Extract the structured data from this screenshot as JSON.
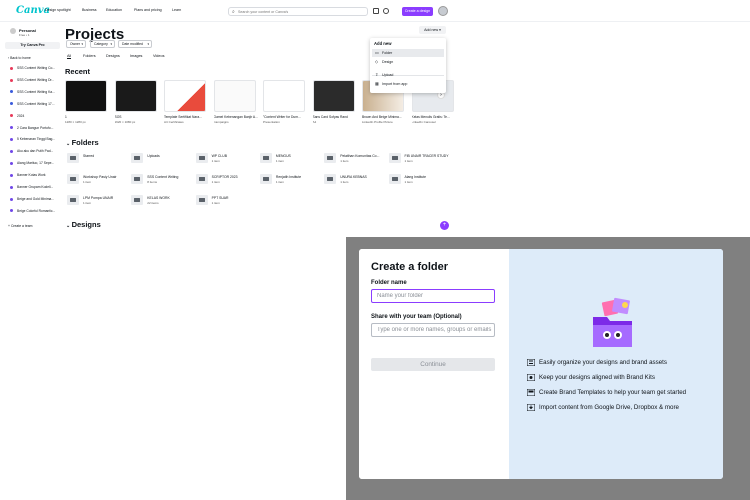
{
  "topbar": {
    "logo": "Canva",
    "nav": [
      "Design spotlight",
      "Business",
      "Education",
      "Plans and pricing",
      "Learn"
    ],
    "search_placeholder": "Search your content or Canva's",
    "create_design": "Create a design"
  },
  "sidebar": {
    "team_name": "Personal",
    "team_sub": "Free • 1",
    "try_pro": "Try Canva Pro",
    "back_home": "Back to home",
    "items": [
      {
        "label": "SSS Content Writing Co...",
        "color": "#e83a5a"
      },
      {
        "label": "SSS Content Writing Dr...",
        "color": "#e83a5a"
      },
      {
        "label": "SSS Content Writing Ka...",
        "color": "#3b5bdb"
      },
      {
        "label": "SSS Content Writing 17...",
        "color": "#3b5bdb"
      },
      {
        "label": "2024",
        "color": "#e83a5a"
      },
      {
        "label": "2 Cara Bangun Portofo...",
        "color": "#7048e8"
      },
      {
        "label": "5 Kebenaran Tinggi Bag...",
        "color": "#7048e8"
      },
      {
        "label": "Aku aku dan Putih Pad...",
        "color": "#7048e8"
      },
      {
        "label": "Alang Marituo, 17 Sepe...",
        "color": "#7048e8"
      },
      {
        "label": "Banner Kotas Work",
        "color": "#7048e8"
      },
      {
        "label": "Banner Grupam Kodell...",
        "color": "#7048e8"
      },
      {
        "label": "Beige and Gold Minima...",
        "color": "#7048e8"
      },
      {
        "label": "Beige Colorful Romantic...",
        "color": "#7048e8"
      }
    ],
    "create_team": "Create a team"
  },
  "main": {
    "title": "Projects",
    "filters": [
      "Owner",
      "Category",
      "Date modified"
    ],
    "tabs": [
      "All",
      "Folders",
      "Designs",
      "Images",
      "Videos"
    ],
    "add_new": "Add new",
    "recent_heading": "Recent",
    "folders_heading": "Folders",
    "designs_heading": "Designs",
    "recent": [
      {
        "title": "1",
        "sub": "1280 × 1280 px"
      },
      {
        "title": "SOS",
        "sub": "1920 × 1080 px"
      },
      {
        "title": "Template Sertifikat Nara...",
        "sub": "Art Certificates"
      },
      {
        "title": "Gamel Kebenangan Banjir A...",
        "sub": "Campaigns"
      },
      {
        "title": "\"Content Writer for Dum...",
        "sub": "Presentation"
      },
      {
        "title": "Sans Card Sofyas Rand",
        "sub": "A4"
      },
      {
        "title": "Brown And Beige Minima...",
        "sub": "LinkedIn Profile Picture"
      },
      {
        "title": "Kelas Menulis Gratis: Te...",
        "sub": "LinkedIn Carousel"
      }
    ],
    "folders": [
      {
        "name": "Starred",
        "count": ""
      },
      {
        "name": "Uploads",
        "count": ""
      },
      {
        "name": "WP CLUB",
        "count": "1 item"
      },
      {
        "name": "MENGUS",
        "count": "1 item"
      },
      {
        "name": "Pelatihan Komunitas Co...",
        "count": "1 item"
      },
      {
        "name": "FIB UNAIR TRACER STUDY",
        "count": "1 item"
      },
      {
        "name": "Workshop Pasiy Unair",
        "count": "1 item"
      },
      {
        "name": "SSS Content Writing",
        "count": "8 items"
      },
      {
        "name": "SCRIPTOR 2023",
        "count": "1 item"
      },
      {
        "name": "Renjatih Institute",
        "count": "1 item"
      },
      {
        "name": "UNURA KEBNAS",
        "count": "1 item"
      },
      {
        "name": "Alang Institute",
        "count": "1 item"
      },
      {
        "name": "LPM Pompa UNAIR",
        "count": "1 item"
      },
      {
        "name": "KELAS WORK",
        "count": "22 items"
      },
      {
        "name": "PPT SUAR",
        "count": "1 item"
      }
    ]
  },
  "dropdown": {
    "title": "Add new",
    "items": [
      {
        "label": "Folder",
        "icon": "folder-icon"
      },
      {
        "label": "Design",
        "icon": "design-icon"
      },
      {
        "label": "Upload",
        "icon": "upload-icon"
      },
      {
        "label": "Import from app",
        "icon": "import-icon"
      }
    ]
  },
  "modal": {
    "title": "Create a folder",
    "folder_name_label": "Folder name",
    "folder_name_placeholder": "Name your folder",
    "share_label": "Share with your team (Optional)",
    "share_placeholder": "Type one or more names, groups or emails",
    "continue": "Continue",
    "features": [
      {
        "icon": "organize-icon",
        "text": "Easily organize your designs and brand assets"
      },
      {
        "icon": "brand-kit-icon",
        "text": "Keep your designs aligned with Brand Kits"
      },
      {
        "icon": "template-icon",
        "text": "Create Brand Templates to help your team get started"
      },
      {
        "icon": "import-content-icon",
        "text": "Import content from Google Drive, Dropbox & more"
      }
    ]
  },
  "colors": {
    "brand": "#8b3dff",
    "canva_logo": "#00c4cc",
    "modal_panel": "#ddebf9"
  }
}
